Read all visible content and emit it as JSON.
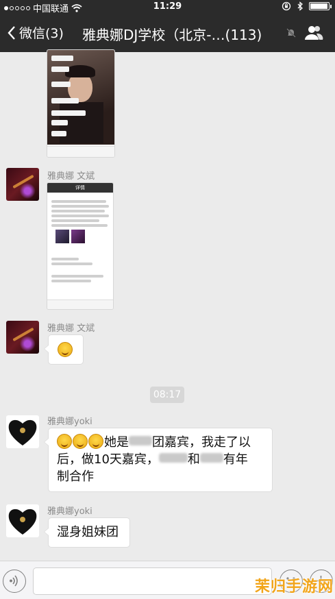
{
  "status_bar": {
    "carrier": "中国联通",
    "time": "11:29"
  },
  "nav": {
    "back_label": "微信(3)",
    "title": "雅典娜DJ学校（北京-…(113)"
  },
  "messages": [
    {
      "sender": "雅典娜 文斌",
      "type": "image"
    },
    {
      "sender": "雅典娜 文斌",
      "type": "emoji"
    },
    {
      "sender": "雅典娜yoki",
      "text_1": "她是",
      "text_2": "团嘉宾，我走了以",
      "text_3": "后，做10天嘉宾，",
      "text_4": "和",
      "text_5": "有年",
      "text_6": "制合作"
    },
    {
      "sender": "雅典娜yoki",
      "text": "湿身姐妹团"
    }
  ],
  "timestamp": "08:17",
  "screenshot_title": "详情",
  "watermark": "茉归手游网",
  "icons": [
    "back-chevron-icon",
    "mute-icon",
    "group-members-icon",
    "voice-icon",
    "emoji-icon",
    "plus-icon",
    "wifi-icon",
    "lock-rotation-icon",
    "bluetooth-icon",
    "battery-icon"
  ]
}
